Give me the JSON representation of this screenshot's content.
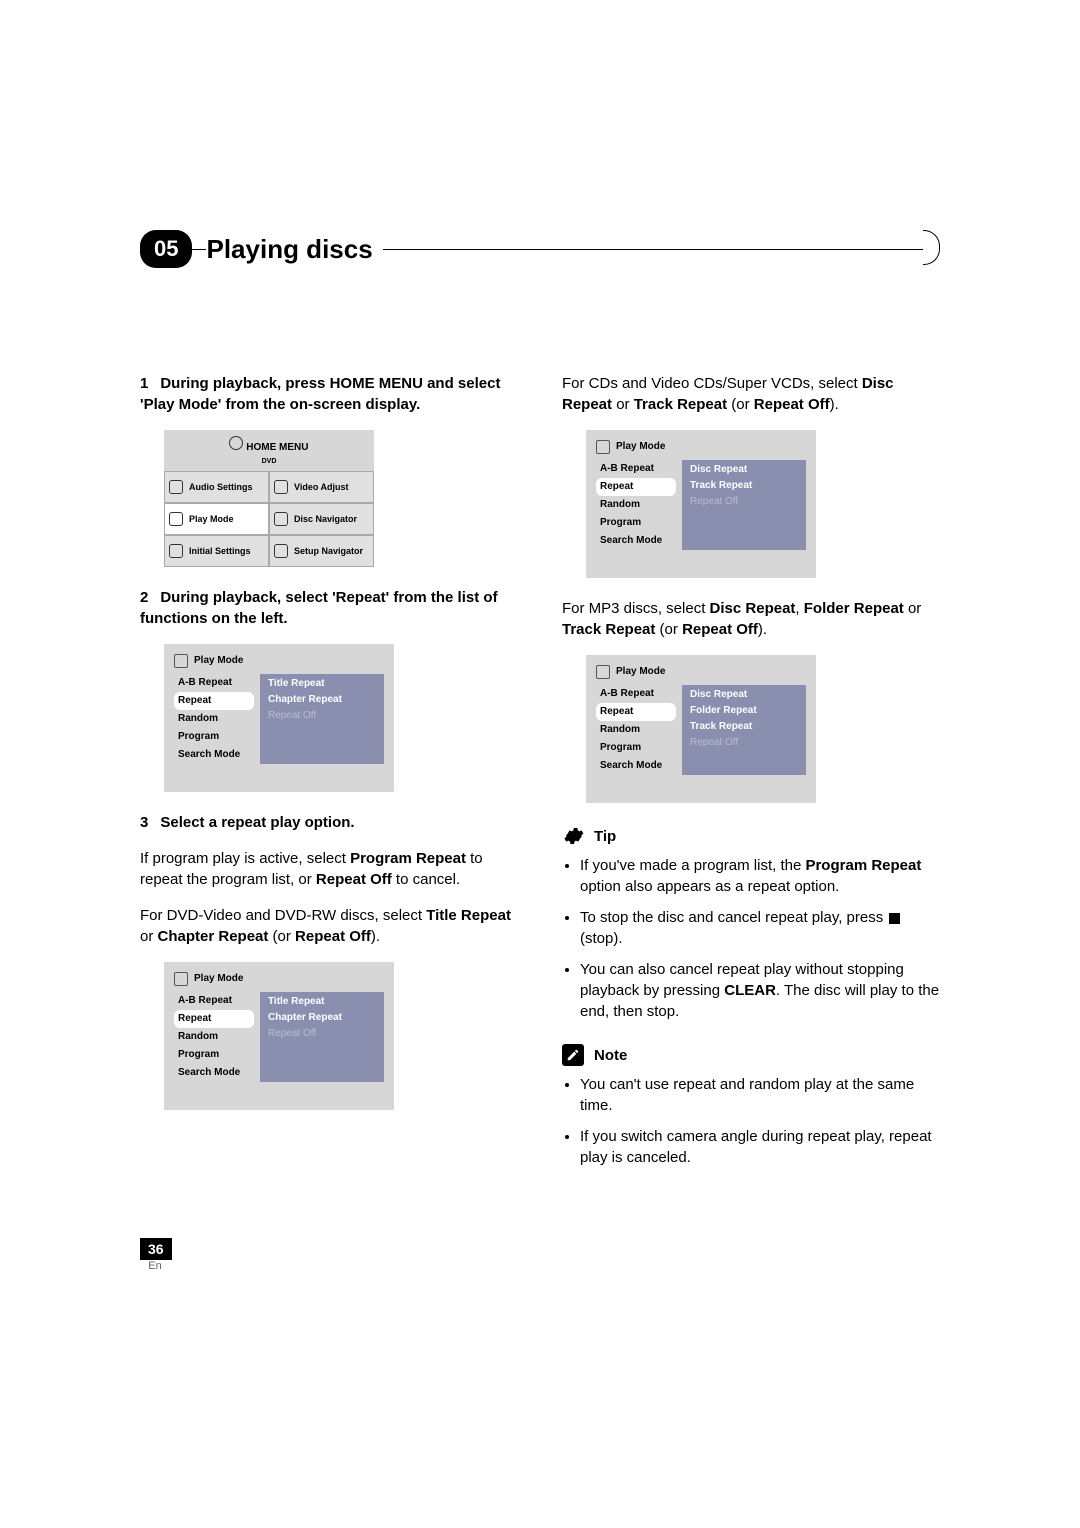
{
  "chapter": {
    "num": "05",
    "title": "Playing discs"
  },
  "col1": {
    "step1": {
      "num": "1",
      "text_a": "During playback, press HOME MENU and select 'Play Mode' from the on-screen display."
    },
    "home_menu": {
      "title": "HOME MENU",
      "sub": "DVD",
      "cells": [
        "Audio Settings",
        "Video Adjust",
        "Play Mode",
        "Disc Navigator",
        "Initial Settings",
        "Setup Navigator"
      ]
    },
    "step2": {
      "num": "2",
      "text_a": "During playback, select 'Repeat' from the list of functions on the left."
    },
    "screen2": {
      "title": "Play Mode",
      "left": [
        "A-B Repeat",
        "Repeat",
        "Random",
        "Program",
        "Search Mode"
      ],
      "right": [
        "Title Repeat",
        "Chapter Repeat",
        "Repeat Off"
      ]
    },
    "step3": {
      "num": "3",
      "title": "Select a repeat play option."
    },
    "step3_p1a": "If program play is active, select ",
    "step3_p1b": "Program Repeat",
    "step3_p1c": " to repeat the program list, or ",
    "step3_p1d": "Repeat Off",
    "step3_p1e": " to cancel.",
    "step3_p2a": "For DVD-Video and DVD-RW discs, select ",
    "step3_p2b": "Title Repeat",
    "step3_p2c": " or ",
    "step3_p2d": "Chapter Repeat",
    "step3_p2e": " (or ",
    "step3_p2f": "Repeat Off",
    "step3_p2g": ").",
    "screen3": {
      "title": "Play Mode",
      "left": [
        "A-B Repeat",
        "Repeat",
        "Random",
        "Program",
        "Search Mode"
      ],
      "right": [
        "Title Repeat",
        "Chapter Repeat",
        "Repeat Off"
      ]
    }
  },
  "col2": {
    "p1a": "For CDs and Video CDs/Super VCDs, select ",
    "p1b": "Disc Repeat",
    "p1c": " or ",
    "p1d": "Track Repeat",
    "p1e": " (or ",
    "p1f": "Repeat Off",
    "p1g": ").",
    "screen1": {
      "title": "Play Mode",
      "left": [
        "A-B Repeat",
        "Repeat",
        "Random",
        "Program",
        "Search Mode"
      ],
      "right": [
        "Disc Repeat",
        "Track Repeat",
        "Repeat Off"
      ]
    },
    "p2a": "For MP3 discs, select ",
    "p2b": "Disc Repeat",
    "p2c": ", ",
    "p2d": "Folder Repeat",
    "p2e": " or ",
    "p2f": "Track Repeat",
    "p2g": " (or ",
    "p2h": "Repeat Off",
    "p2i": ").",
    "screen2": {
      "title": "Play Mode",
      "left": [
        "A-B Repeat",
        "Repeat",
        "Random",
        "Program",
        "Search Mode"
      ],
      "right": [
        "Disc Repeat",
        "Folder Repeat",
        "Track Repeat",
        "Repeat Off"
      ]
    },
    "tip": {
      "title": "Tip",
      "b1a": "If you've made a program list, the ",
      "b1b": "Program Repeat",
      "b1c": " option also appears as a repeat option.",
      "b2a": "To stop the disc and cancel repeat play, press ",
      "b2b": " (stop).",
      "b3a": "You can also cancel repeat play without stopping playback by pressing ",
      "b3b": "CLEAR",
      "b3c": ". The disc will play to the end, then stop."
    },
    "note": {
      "title": "Note",
      "b1": "You can't use repeat and random play at the same time.",
      "b2": "If you switch camera angle during repeat play, repeat play is canceled."
    }
  },
  "footer": {
    "page": "36",
    "lang": "En"
  }
}
